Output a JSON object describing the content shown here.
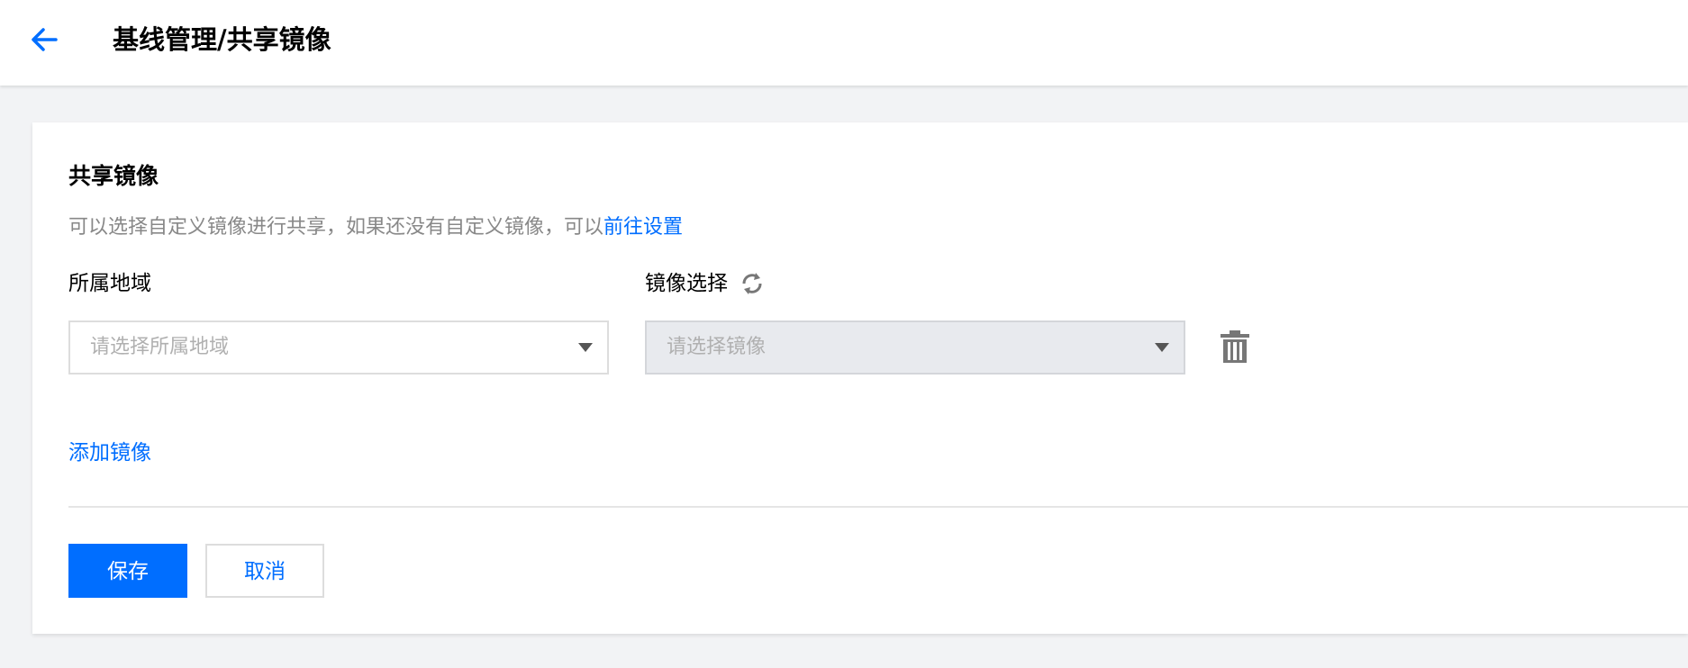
{
  "header": {
    "title": "基线管理/共享镜像",
    "back_icon": "arrow-left-icon"
  },
  "card": {
    "title": "共享镜像",
    "description": "可以选择自定义镜像进行共享，如果还没有自定义镜像，可以",
    "description_link": "前往设置",
    "region_label": "所属地域",
    "region_placeholder": "请选择所属地域",
    "image_label": "镜像选择",
    "image_placeholder": "请选择镜像",
    "add_image": "添加镜像"
  },
  "actions": {
    "save": "保存",
    "cancel": "取消"
  },
  "colors": {
    "accent": "#006eff",
    "disabled_bg": "#e8eaee",
    "page_bg": "#f2f3f5"
  }
}
